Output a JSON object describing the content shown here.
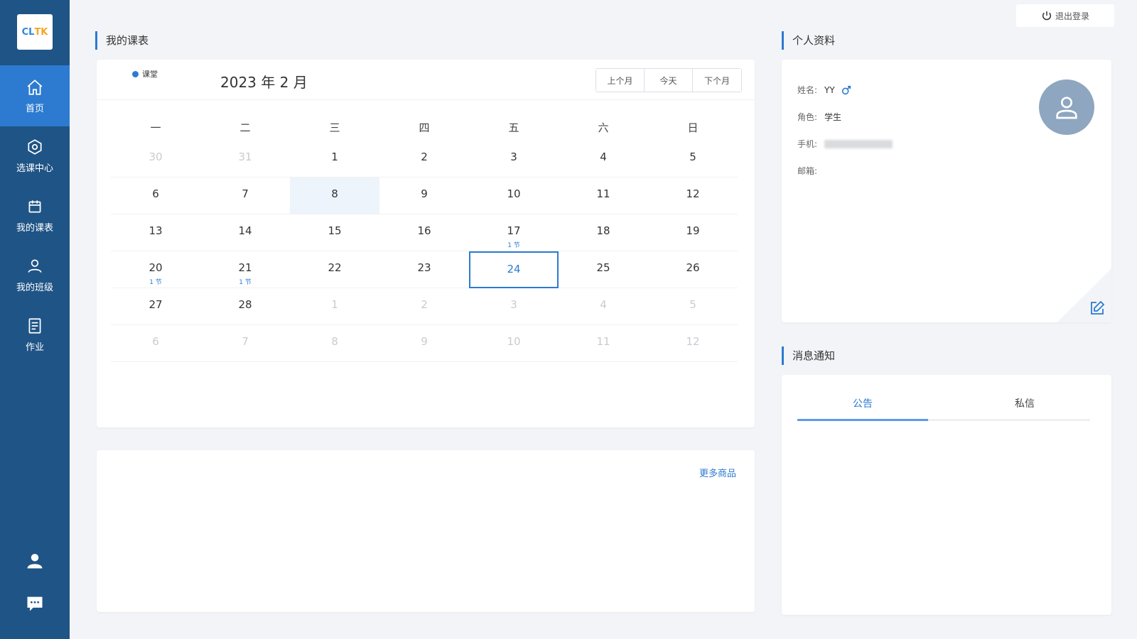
{
  "sidebar": {
    "logo": {
      "part1": "CL",
      "part2": "TK"
    },
    "items": [
      {
        "label": "首页",
        "icon": "home-icon"
      },
      {
        "label": "选课中心",
        "icon": "course-center-icon"
      },
      {
        "label": "我的课表",
        "icon": "calendar-icon"
      },
      {
        "label": "我的班级",
        "icon": "user-icon"
      },
      {
        "label": "作业",
        "icon": "homework-icon"
      }
    ],
    "bottom_icons": [
      "profile-icon",
      "message-icon"
    ]
  },
  "header": {
    "logout_label": "退出登录"
  },
  "schedule": {
    "section_title": "我的课表",
    "legend_label": "课堂",
    "month_title": "2023 年 2 月",
    "buttons": {
      "prev": "上个月",
      "today": "今天",
      "next": "下个月"
    },
    "weekdays": [
      "一",
      "二",
      "三",
      "四",
      "五",
      "六",
      "日"
    ],
    "weeks": [
      [
        {
          "d": "30",
          "o": true
        },
        {
          "d": "31",
          "o": true
        },
        {
          "d": "1"
        },
        {
          "d": "2"
        },
        {
          "d": "3"
        },
        {
          "d": "4"
        },
        {
          "d": "5"
        }
      ],
      [
        {
          "d": "6"
        },
        {
          "d": "7"
        },
        {
          "d": "8",
          "s": true
        },
        {
          "d": "9"
        },
        {
          "d": "10"
        },
        {
          "d": "11"
        },
        {
          "d": "12"
        }
      ],
      [
        {
          "d": "13"
        },
        {
          "d": "14"
        },
        {
          "d": "15"
        },
        {
          "d": "16"
        },
        {
          "d": "17",
          "m": "1 节"
        },
        {
          "d": "18"
        },
        {
          "d": "19"
        }
      ],
      [
        {
          "d": "20",
          "m": "1 节"
        },
        {
          "d": "21",
          "m": "1 节"
        },
        {
          "d": "22"
        },
        {
          "d": "23"
        },
        {
          "d": "24",
          "t": true
        },
        {
          "d": "25"
        },
        {
          "d": "26"
        }
      ],
      [
        {
          "d": "27"
        },
        {
          "d": "28"
        },
        {
          "d": "1",
          "o": true
        },
        {
          "d": "2",
          "o": true
        },
        {
          "d": "3",
          "o": true
        },
        {
          "d": "4",
          "o": true
        },
        {
          "d": "5",
          "o": true
        }
      ],
      [
        {
          "d": "6",
          "o": true
        },
        {
          "d": "7",
          "o": true
        },
        {
          "d": "8",
          "o": true
        },
        {
          "d": "9",
          "o": true
        },
        {
          "d": "10",
          "o": true
        },
        {
          "d": "11",
          "o": true
        },
        {
          "d": "12",
          "o": true
        }
      ]
    ]
  },
  "products": {
    "more_label": "更多商品"
  },
  "profile": {
    "section_title": "个人资料",
    "name_label": "姓名:",
    "name_value": "YY",
    "role_label": "角色:",
    "role_value": "学生",
    "phone_label": "手机:",
    "email_label": "邮箱:"
  },
  "notices": {
    "section_title": "消息通知",
    "tabs": [
      "公告",
      "私信"
    ]
  },
  "colors": {
    "sidebar": "#1f5486",
    "accent": "#2c7bd0",
    "background": "#f2f4f7"
  }
}
